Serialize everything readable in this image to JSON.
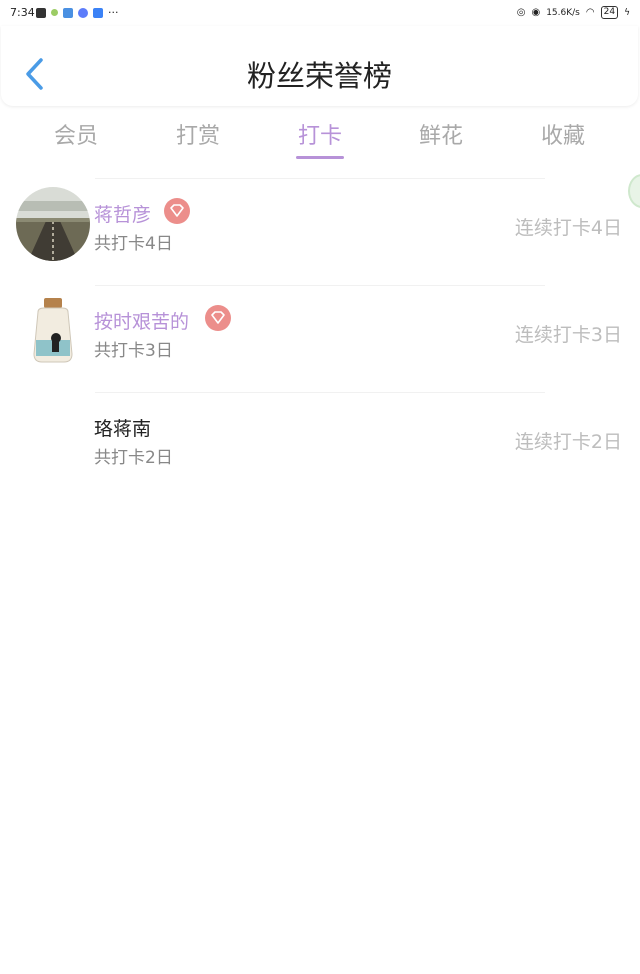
{
  "status_bar": {
    "time": "7:34",
    "dots": "···",
    "network_speed": "15.6K/s",
    "battery": "24"
  },
  "header": {
    "title": "粉丝荣誉榜",
    "back_icon": "chevron-left-icon"
  },
  "tabs": [
    {
      "label": "会员",
      "active": false
    },
    {
      "label": "打赏",
      "active": false
    },
    {
      "label": "打卡",
      "active": true
    },
    {
      "label": "鲜花",
      "active": false
    },
    {
      "label": "收藏",
      "active": false
    }
  ],
  "colors": {
    "accent": "#b792d8",
    "badge": "#ec8e8b",
    "muted": "#bdbdbd"
  },
  "fans": [
    {
      "name": "蒋哲彦",
      "total": "共打卡4日",
      "streak": "连续打卡4日",
      "has_badge": true,
      "avatar": "road-landscape-avatar"
    },
    {
      "name": "按时艰苦的",
      "total": "共打卡3日",
      "streak": "连续打卡3日",
      "has_badge": true,
      "avatar": "jar-avatar"
    },
    {
      "name": "珞蒋南",
      "total": "共打卡2日",
      "streak": "连续打卡2日",
      "has_badge": false,
      "avatar": ""
    }
  ]
}
